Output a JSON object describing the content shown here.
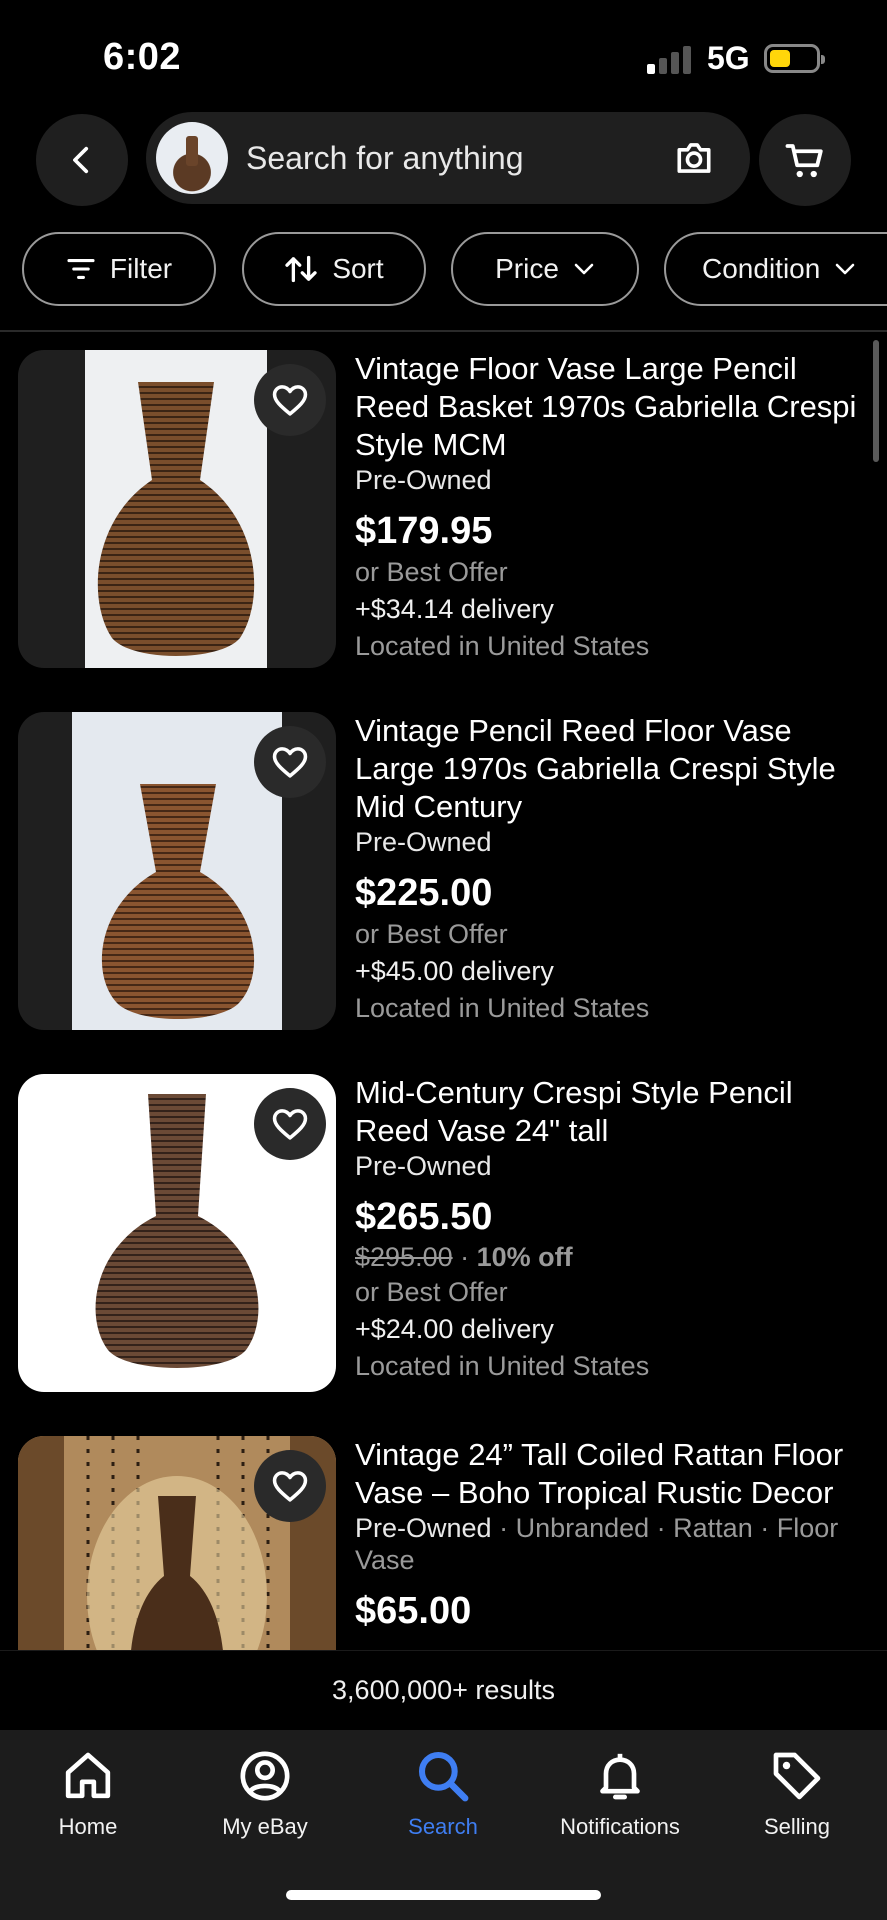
{
  "status": {
    "time": "6:02",
    "network": "5G",
    "battery_level": 0.45,
    "signal_bars_active": 1,
    "signal_bars_total": 4
  },
  "search": {
    "placeholder": "Search for anything"
  },
  "chips": [
    {
      "label": "Filter",
      "icon": "filter-icon"
    },
    {
      "label": "Sort",
      "icon": "sort-icon"
    },
    {
      "label": "Price",
      "icon": "chevron-down-icon"
    },
    {
      "label": "Condition",
      "icon": "chevron-down-icon"
    }
  ],
  "listings": [
    {
      "title": "Vintage Floor Vase Large Pencil Reed Basket 1970s Gabriella Crespi Style MCM",
      "condition": "Pre-Owned",
      "price": "$179.95",
      "best_offer": "or Best Offer",
      "delivery": "+$34.14 delivery",
      "location": "Located in United States"
    },
    {
      "title": "Vintage Pencil Reed Floor Vase Large 1970s Gabriella Crespi Style Mid Century",
      "condition": "Pre-Owned",
      "price": "$225.00",
      "best_offer": "or Best Offer",
      "delivery": "+$45.00 delivery",
      "location": "Located in United States"
    },
    {
      "title": "Mid-Century Crespi Style Pencil Reed Vase 24\" tall",
      "condition": "Pre-Owned",
      "price": "$265.50",
      "original_price": "$295.00",
      "discount": "10% off",
      "best_offer": "or Best Offer",
      "delivery": "+$24.00 delivery",
      "location": "Located in United States"
    },
    {
      "title": "Vintage 24” Tall Coiled Rattan Floor Vase – Boho Tropical Rustic Decor",
      "condition": "Pre-Owned",
      "meta": "· Unbranded · Rattan · Floor Vase",
      "price": "$65.00"
    }
  ],
  "results": {
    "count_text": "3,600,000+ results"
  },
  "tabs": [
    {
      "label": "Home",
      "icon": "home-icon",
      "active": false
    },
    {
      "label": "My eBay",
      "icon": "profile-icon",
      "active": false
    },
    {
      "label": "Search",
      "icon": "search-icon",
      "active": true
    },
    {
      "label": "Notifications",
      "icon": "bell-icon",
      "active": false
    },
    {
      "label": "Selling",
      "icon": "tag-icon",
      "active": false
    }
  ],
  "colors": {
    "accent": "#3f7ef2",
    "background": "#000000",
    "surface": "#1f1f1f",
    "muted_text": "#9a9a9a",
    "battery": "#ffd60a"
  }
}
